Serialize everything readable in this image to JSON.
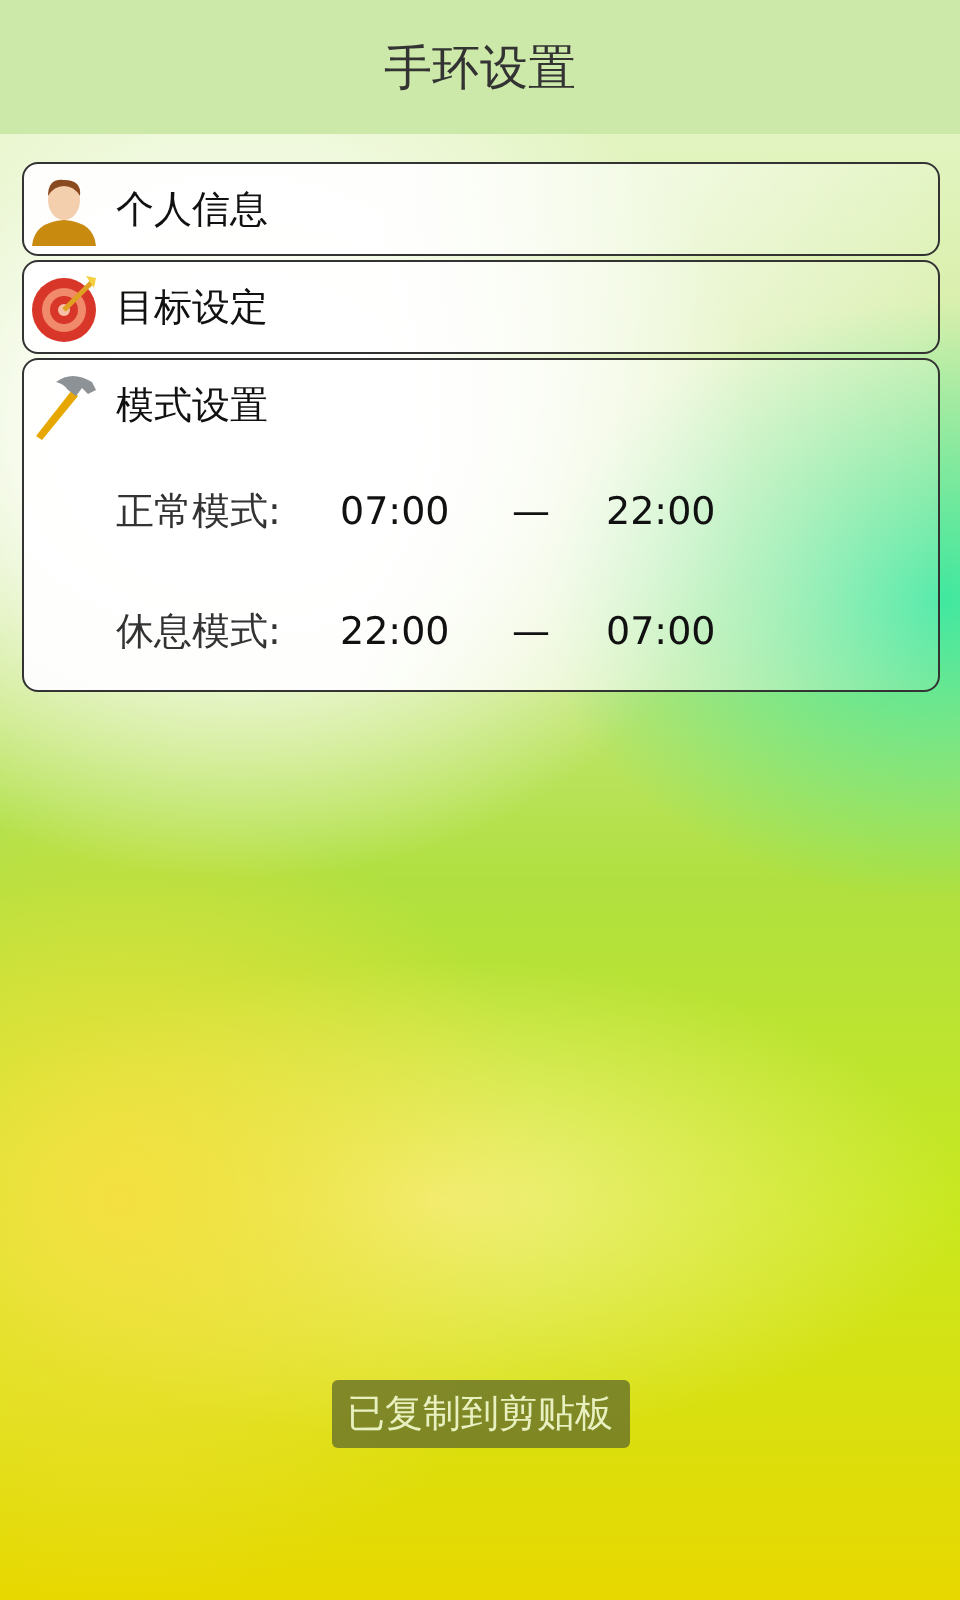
{
  "title_bar": {
    "title": "手环设置"
  },
  "sections": [
    {
      "kind": "link",
      "label": "个人信息"
    },
    {
      "kind": "link",
      "label": "目标设定"
    },
    {
      "kind": "modes",
      "label": "模式设置",
      "modes": [
        {
          "label": "正常模式:",
          "start": "07:00",
          "separator": "—",
          "end": "22:00"
        },
        {
          "label": "休息模式:",
          "start": "22:00",
          "separator": "—",
          "end": "07:00"
        }
      ]
    }
  ],
  "toast": "已复制到剪贴板"
}
